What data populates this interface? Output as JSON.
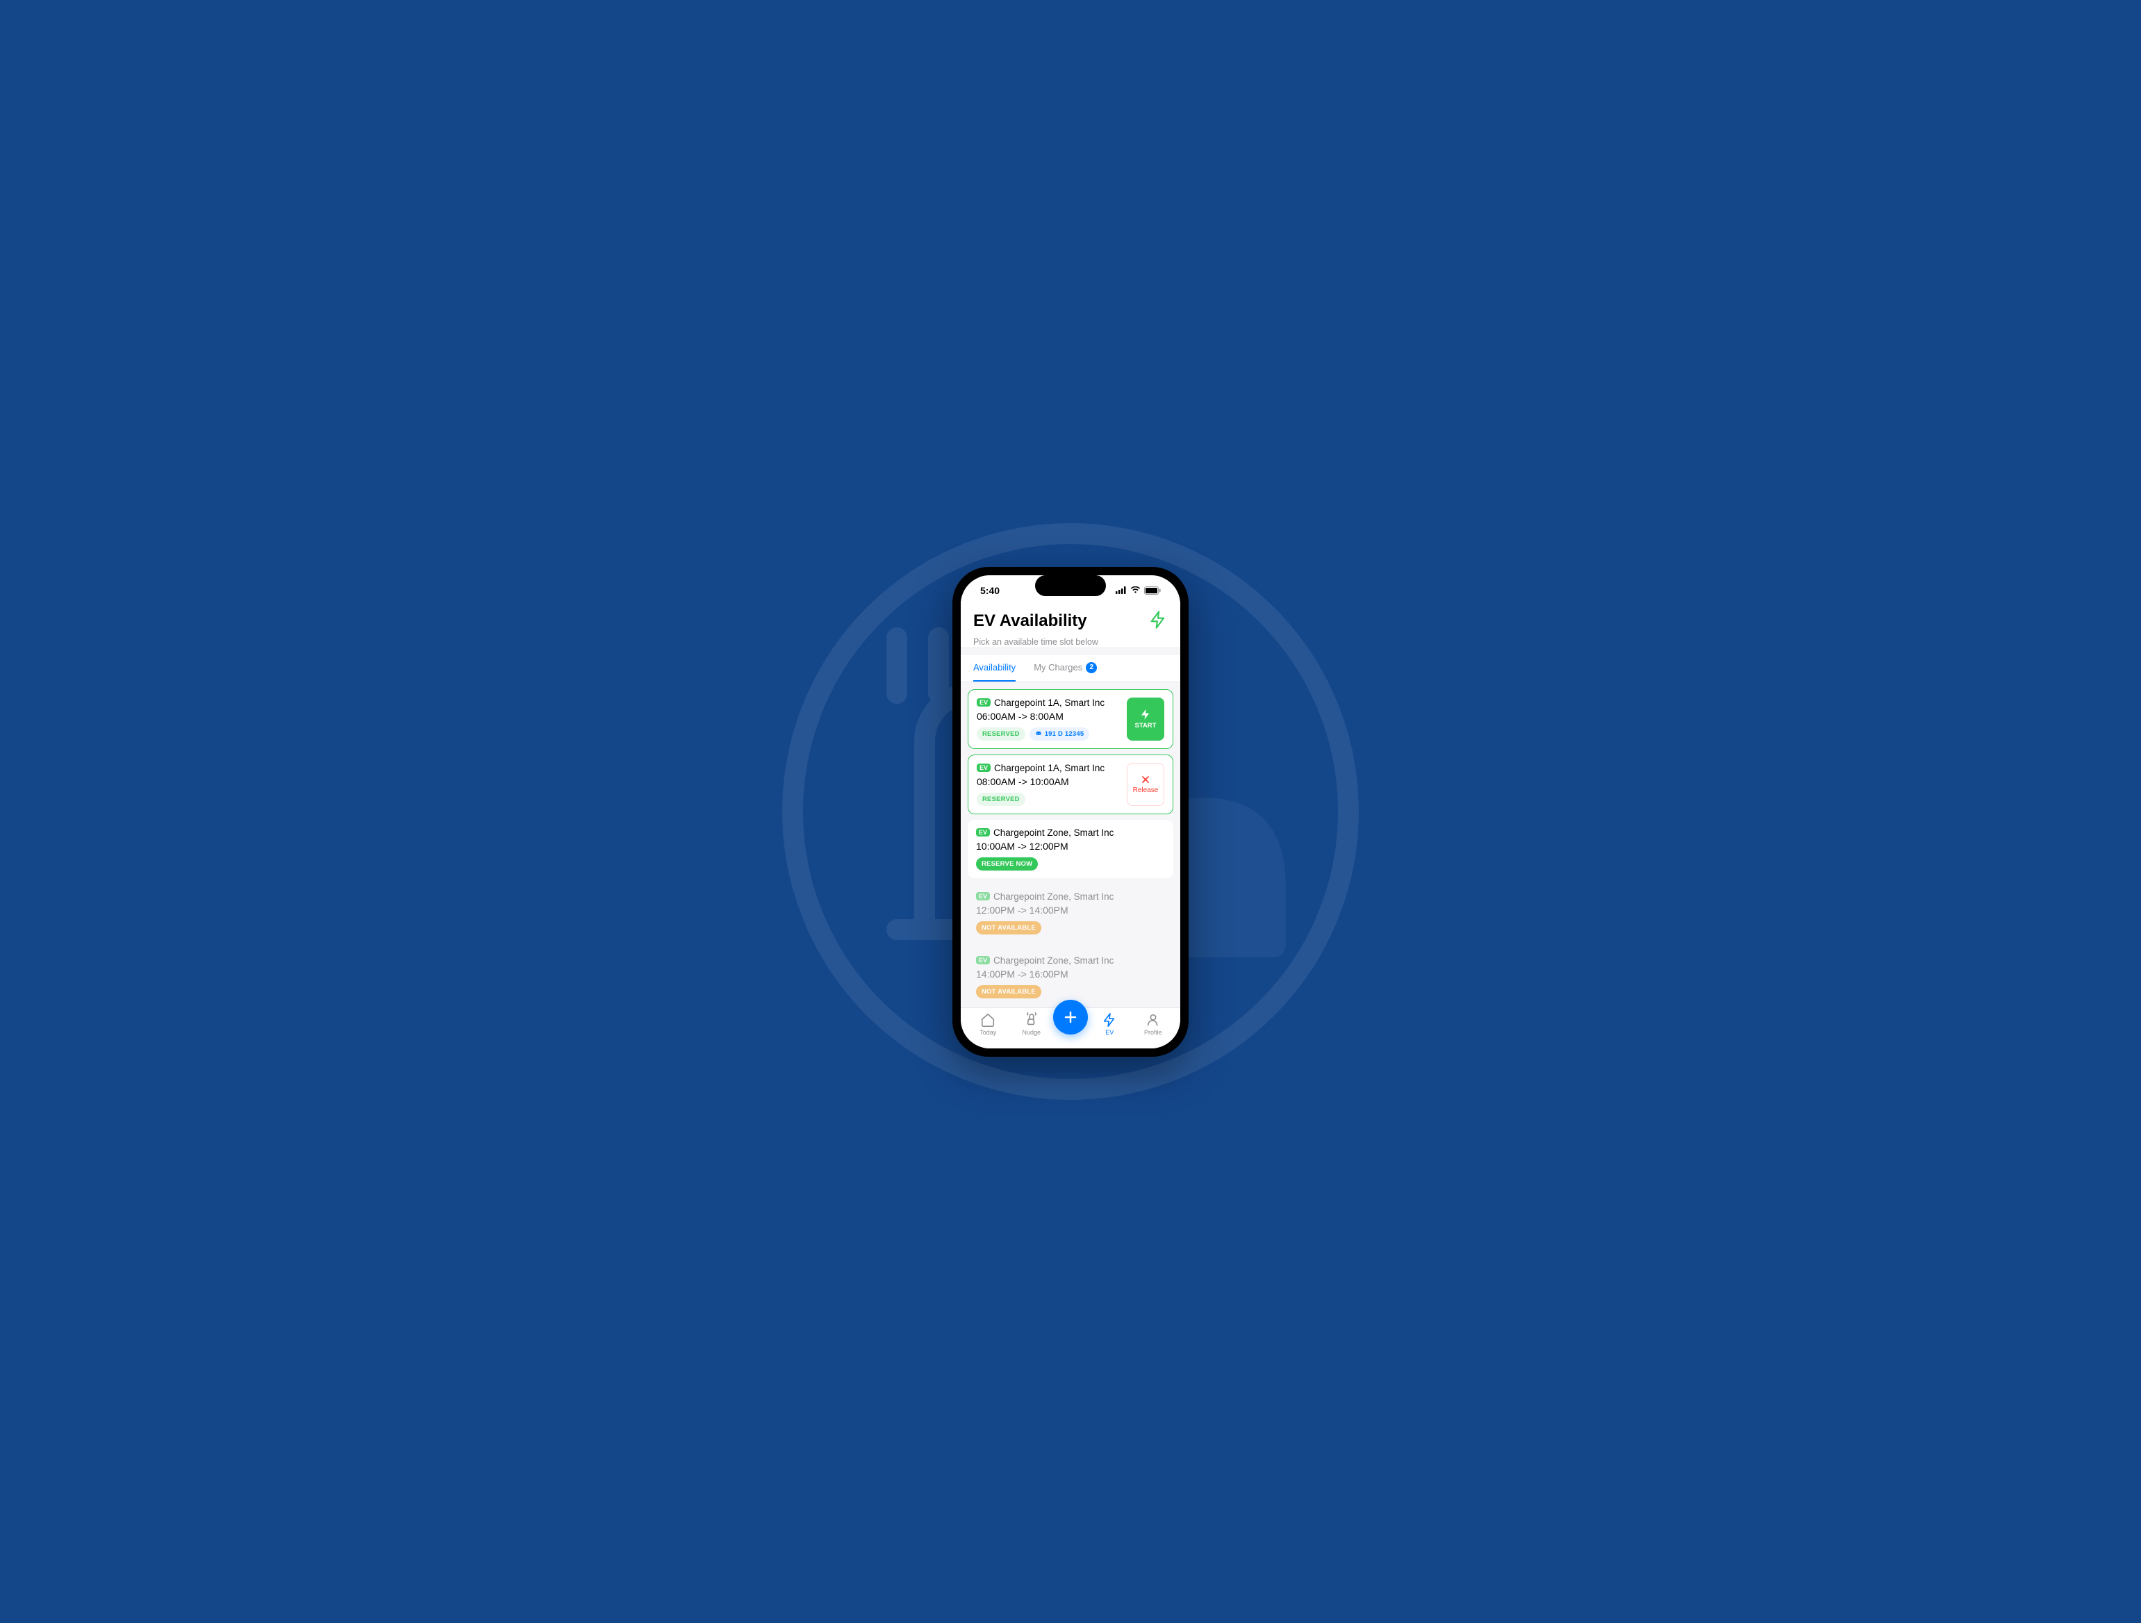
{
  "status": {
    "time": "5:40"
  },
  "header": {
    "title": "EV Availability",
    "subtitle": "Pick an available time slot below"
  },
  "tabs": {
    "availability": "Availability",
    "my_charges": "My Charges",
    "my_charges_count": "2"
  },
  "ev_badge": "EV",
  "slots": [
    {
      "name": "Chargepoint 1A, Smart Inc",
      "time": "06:00AM -> 8:00AM",
      "status": "RESERVED",
      "vehicle": "191 D 12345",
      "action": "START"
    },
    {
      "name": "Chargepoint 1A, Smart Inc",
      "time": "08:00AM -> 10:00AM",
      "status": "RESERVED",
      "action": "Release"
    },
    {
      "name": "Chargepoint Zone, Smart Inc",
      "time": "10:00AM -> 12:00PM",
      "status": "RESERVE NOW"
    },
    {
      "name": "Chargepoint Zone, Smart Inc",
      "time": "12:00PM -> 14:00PM",
      "status": "NOT AVAILABLE"
    },
    {
      "name": "Chargepoint Zone, Smart Inc",
      "time": "14:00PM -> 16:00PM",
      "status": "NOT AVAILABLE"
    }
  ],
  "nav": {
    "today": "Today",
    "nudge": "Nudge",
    "ev": "EV",
    "profile": "Profile"
  }
}
